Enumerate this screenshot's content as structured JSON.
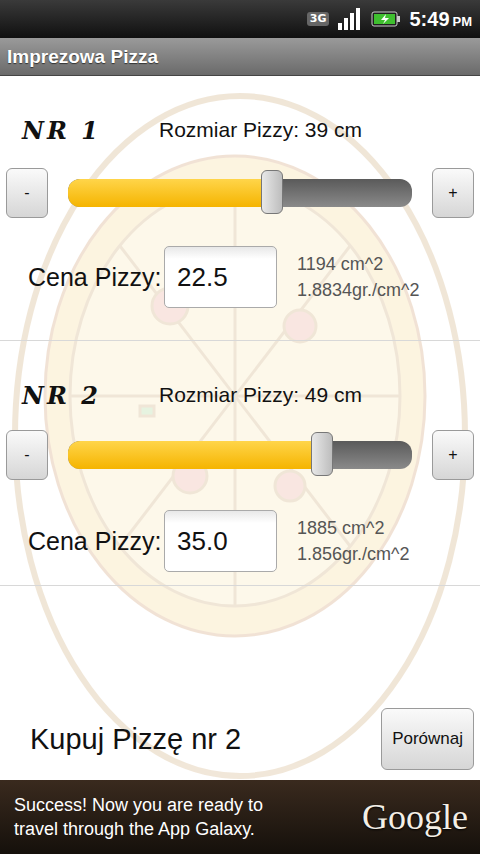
{
  "status_bar": {
    "network": "3G",
    "time": "5:49",
    "meridiem": "PM"
  },
  "title": "Imprezowa Pizza",
  "pizzas": [
    {
      "label": "NR 1",
      "size_label": "Rozmiar Pizzy: 39 cm",
      "minus": "-",
      "plus": "+",
      "level": 0.593,
      "price_label": "Cena Pizzy:",
      "price": "22.5",
      "area": "1194 cm^2",
      "unit_price": "1.8834gr./cm^2"
    },
    {
      "label": "NR 2",
      "size_label": "Rozmiar Pizzy: 49 cm",
      "minus": "-",
      "plus": "+",
      "level": 0.738,
      "price_label": "Cena Pizzy:",
      "price": "35.0",
      "area": "1885 cm^2",
      "unit_price": "1.856gr./cm^2"
    }
  ],
  "result": "Kupuj Pizzę nr 2",
  "compare_button": "Porównaj",
  "ad": {
    "lines": [
      "Success! Now you are ready to",
      "travel through the App Galaxy."
    ],
    "logo": "Google"
  }
}
